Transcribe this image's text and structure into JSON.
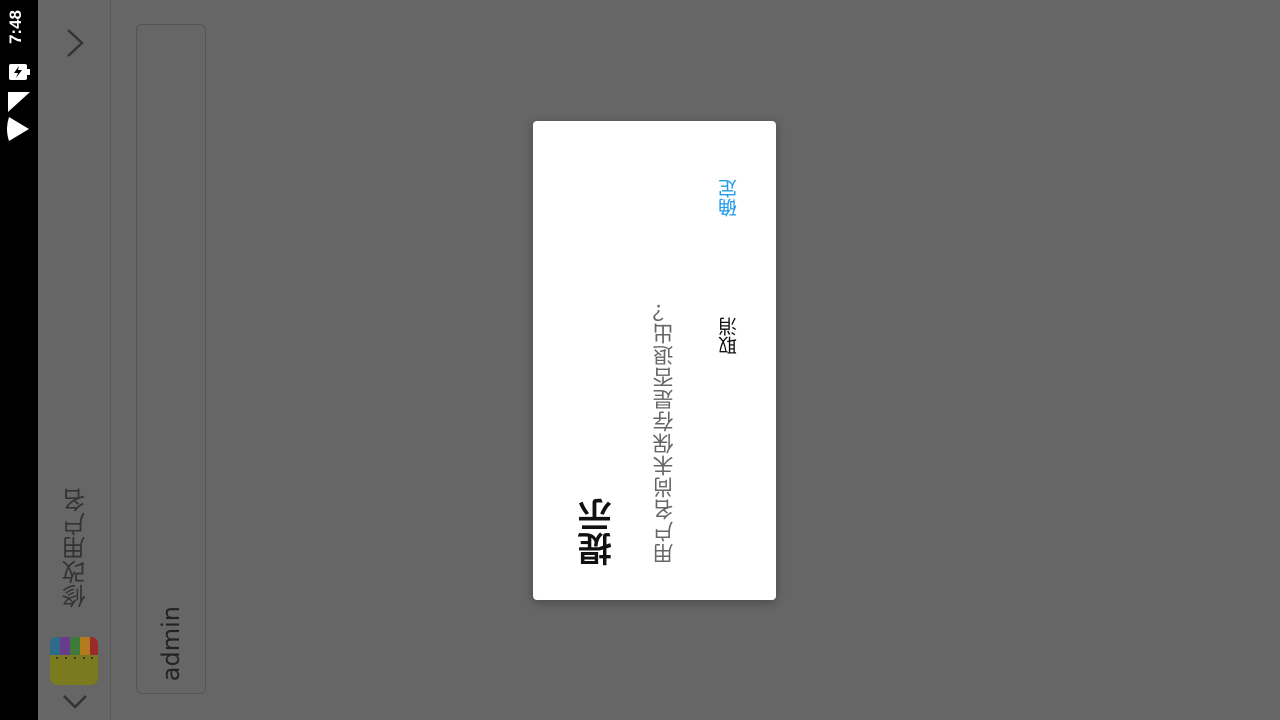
{
  "status_bar": {
    "time": "7:48",
    "icons": [
      "battery-charging-icon",
      "signal-icon",
      "wifi-icon"
    ]
  },
  "app_bar": {
    "title": "修改用户名",
    "forward_icon": "chevron-right-icon",
    "back_icon": "chevron-down-icon",
    "logo_icon": "app-logo-icon"
  },
  "form": {
    "username_value": "admin"
  },
  "dialog": {
    "title": "提示",
    "message": "用户名尚未保存是否退出？",
    "confirm_label": "确定",
    "cancel_label": "取消",
    "accent_color": "#1e9be9"
  },
  "colors": {
    "overlay": "#666666",
    "dialog_bg": "#ffffff",
    "status_bar": "#000000"
  }
}
